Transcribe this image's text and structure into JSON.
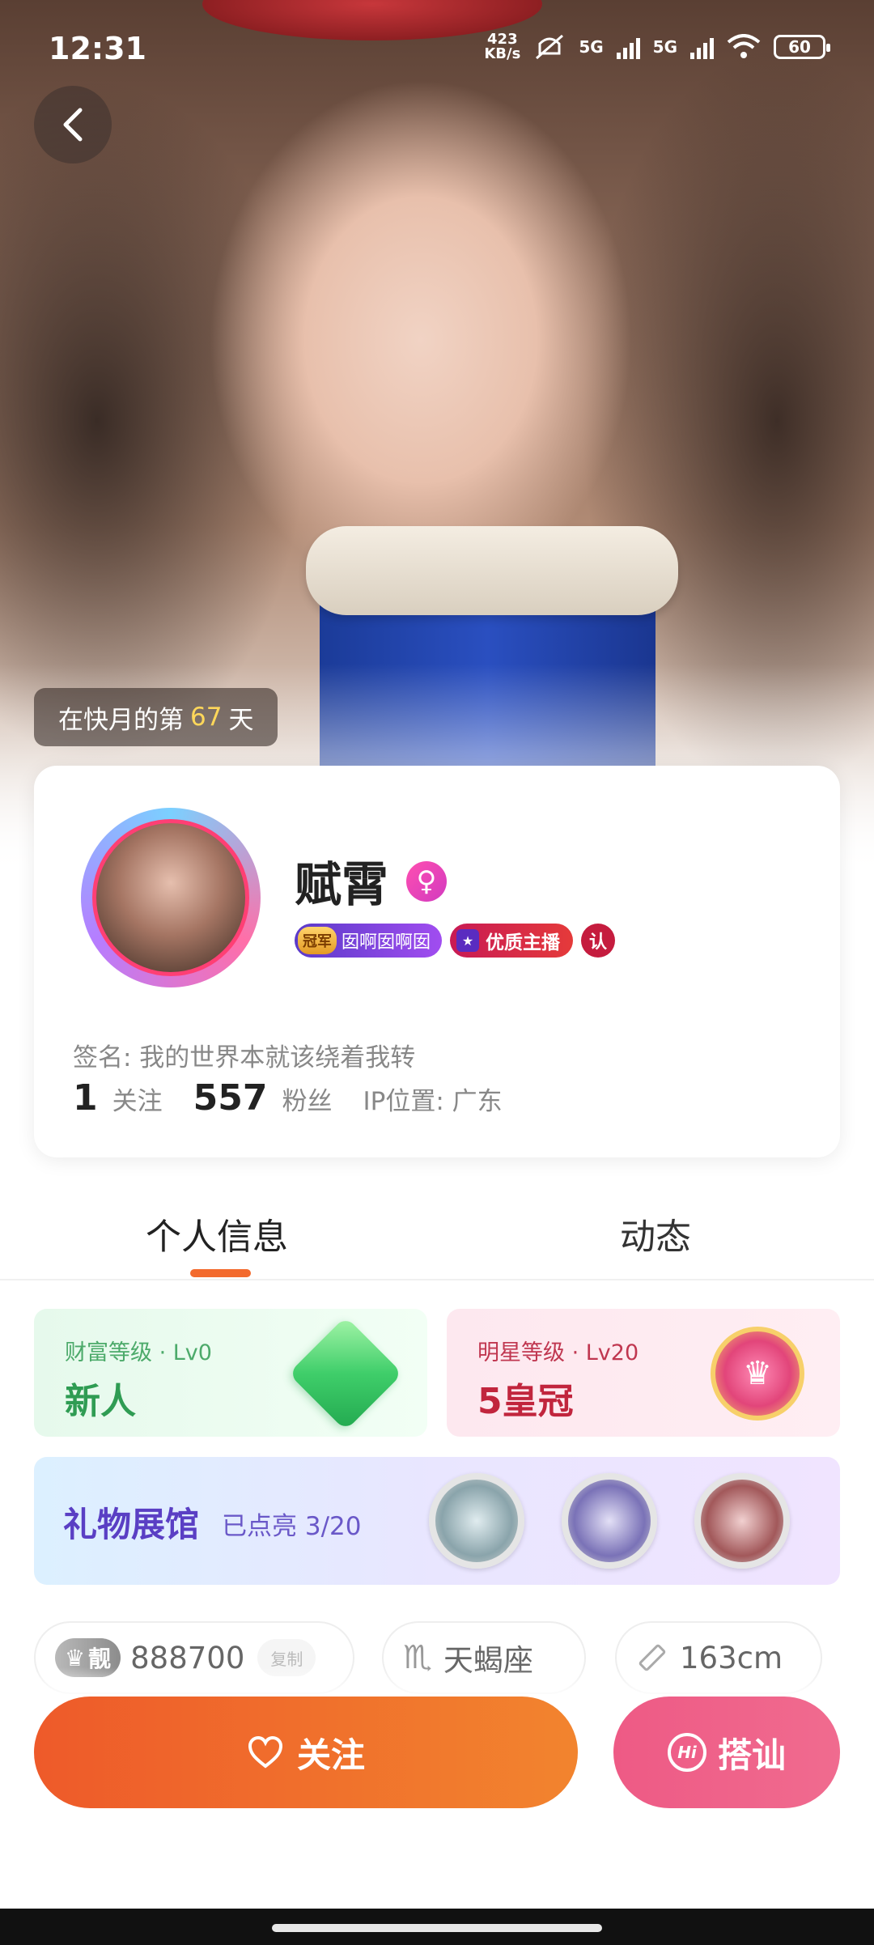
{
  "status_bar": {
    "time": "12:31",
    "net_speed_value": "423",
    "net_speed_unit": "KB/s",
    "net_1": "5G",
    "net_2": "5G",
    "battery": "60"
  },
  "hero": {
    "days_prefix": "在快月的第",
    "days_value": "67",
    "days_suffix": "天"
  },
  "profile": {
    "name": "赋霄",
    "guard_tag": "冠军",
    "guard_name": "囡啊囡啊囡",
    "quality_badge": "优质主播",
    "verify_badge": "认",
    "signature": "签名: 我的世界本就该绕着我转",
    "following_count": "1",
    "following_label": "关注",
    "fans_count": "557",
    "fans_label": "粉丝",
    "ip_location": "IP位置: 广东"
  },
  "tabs": [
    "个人信息",
    "动态"
  ],
  "levels": {
    "wealth_label": "财富等级 · Lv0",
    "wealth_value": "新人",
    "star_label": "明星等级 · Lv20",
    "star_value": "5皇冠"
  },
  "gift_hall": {
    "title": "礼物展馆",
    "progress_text": "已点亮 3/20"
  },
  "info_pills": {
    "liang_label": "靓",
    "id_number": "888700",
    "copy_label": "复制",
    "zodiac": "天蝎座",
    "height": "163cm"
  },
  "actions": {
    "follow_label": "关注",
    "chat_label": "搭讪"
  },
  "colors": {
    "accent_orange": "#f36a2d",
    "chat_pink": "#ee5a85",
    "wealth_green": "#2f9c53",
    "star_red": "#c1253d",
    "gift_purple": "#5a3fc4"
  }
}
